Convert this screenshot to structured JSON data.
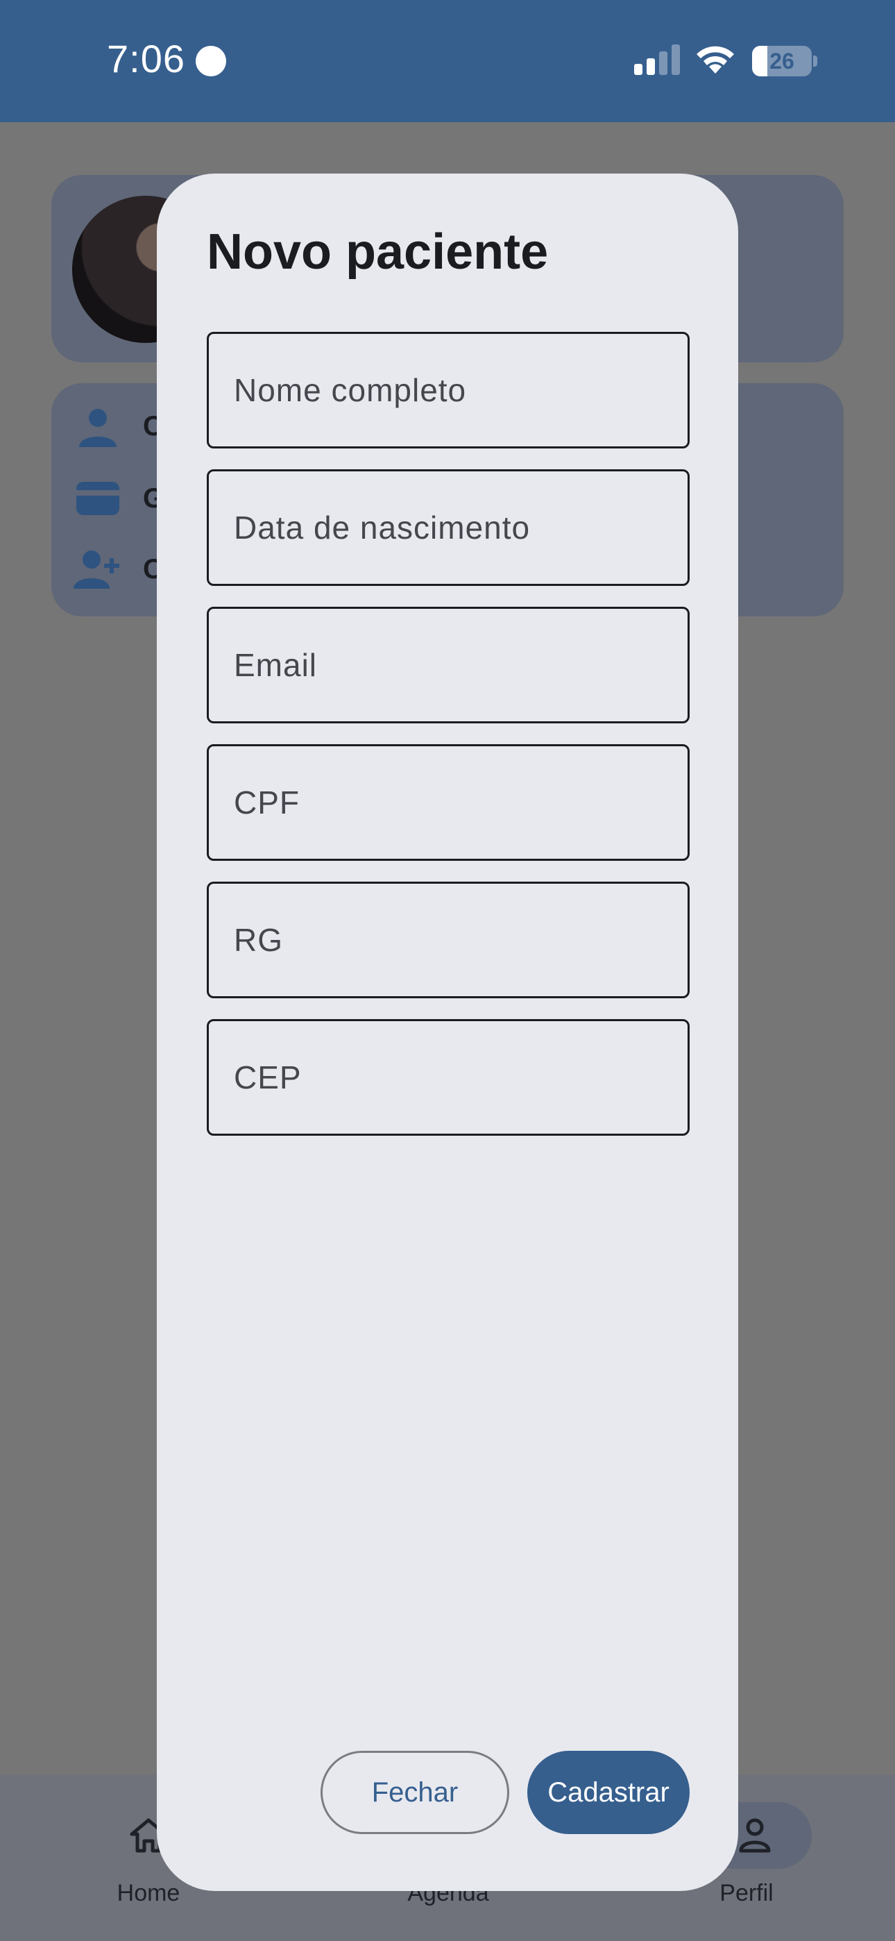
{
  "status_bar": {
    "time": "7:06",
    "battery_level": "26",
    "battery_fraction": 0.26,
    "icons": [
      "recording-dot-icon",
      "cellular-signal-icon",
      "wifi-icon",
      "battery-icon"
    ]
  },
  "background": {
    "options_partial": [
      "C",
      "G",
      "C"
    ],
    "option_icons": [
      "person-icon",
      "wallet-icon",
      "person-add-icon"
    ]
  },
  "bottom_nav": {
    "items": [
      {
        "label": "Home",
        "icon": "home-icon"
      },
      {
        "label": "Agenda",
        "icon": "calendar-icon"
      },
      {
        "label": "Perfil",
        "icon": "person-outline-icon",
        "active": true
      }
    ]
  },
  "dialog": {
    "title": "Novo paciente",
    "fields": [
      {
        "placeholder": "Nome completo",
        "value": ""
      },
      {
        "placeholder": "Data de nascimento",
        "value": ""
      },
      {
        "placeholder": "Email",
        "value": ""
      },
      {
        "placeholder": "CPF",
        "value": ""
      },
      {
        "placeholder": "RG",
        "value": ""
      },
      {
        "placeholder": "CEP",
        "value": ""
      }
    ],
    "close_label": "Fechar",
    "submit_label": "Cadastrar"
  },
  "colors": {
    "primary": "#365f8e",
    "surface": "#e8e9ef",
    "scrim": "#767676"
  }
}
